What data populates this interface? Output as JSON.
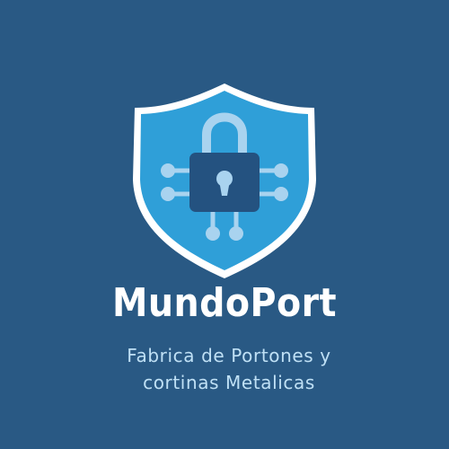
{
  "colors": {
    "background": "#295984",
    "shield_fill": "#2f9fd8",
    "shield_border": "#ffffff",
    "lock_body": "#245280",
    "circuit": "#a9d3ef",
    "keyhole": "#a9d3ef",
    "brand_text": "#ffffff",
    "tagline_text": "#bfe0f5"
  },
  "logo": {
    "icon": "shield-padlock-circuit-icon",
    "brand_name": "MundoPort",
    "tagline_line1": "Fabrica de Portones y",
    "tagline_line2": "cortinas Metalicas"
  }
}
